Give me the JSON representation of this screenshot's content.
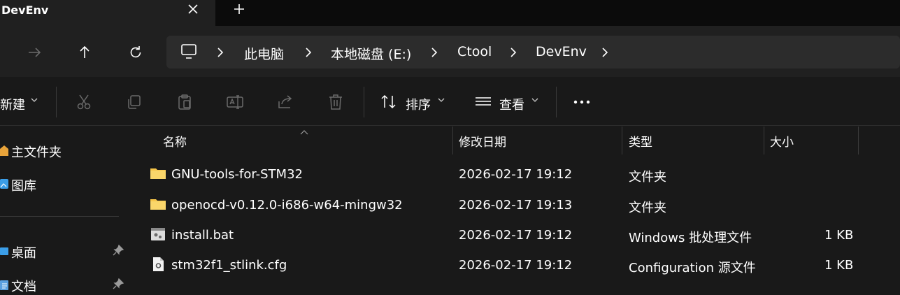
{
  "tab": {
    "title": "DevEnv"
  },
  "breadcrumb": {
    "items": [
      "此电脑",
      "本地磁盘 (E:)",
      "Ctool",
      "DevEnv"
    ]
  },
  "toolbar": {
    "new_label": "新建",
    "sort_label": "排序",
    "view_label": "查看"
  },
  "sidebar": {
    "items": [
      {
        "label": "主文件夹",
        "icon": "home-icon"
      },
      {
        "label": "图库",
        "icon": "gallery-icon"
      },
      {
        "label": "桌面",
        "icon": "desktop-icon",
        "pinned": true
      },
      {
        "label": "文档",
        "icon": "documents-icon",
        "pinned": true
      }
    ]
  },
  "columns": {
    "name": "名称",
    "modified": "修改日期",
    "type": "类型",
    "size": "大小"
  },
  "files": [
    {
      "name": "GNU-tools-for-STM32",
      "modified": "2026-02-17 19:12",
      "type": "文件夹",
      "size": "",
      "icon": "folder-icon"
    },
    {
      "name": "openocd-v0.12.0-i686-w64-mingw32",
      "modified": "2026-02-17 19:13",
      "type": "文件夹",
      "size": "",
      "icon": "folder-icon"
    },
    {
      "name": "install.bat",
      "modified": "2026-02-17 19:12",
      "type": "Windows 批处理文件",
      "size": "1 KB",
      "icon": "batch-file-icon"
    },
    {
      "name": "stm32f1_stlink.cfg",
      "modified": "2026-02-17 19:12",
      "type": "Configuration 源文件",
      "size": "1 KB",
      "icon": "config-file-icon"
    }
  ],
  "colors": {
    "background": "#191919",
    "chrome": "#202020",
    "address_bg": "#2c2c2c",
    "folder": "#f7c64a",
    "accent_blue": "#3b9ee8"
  }
}
